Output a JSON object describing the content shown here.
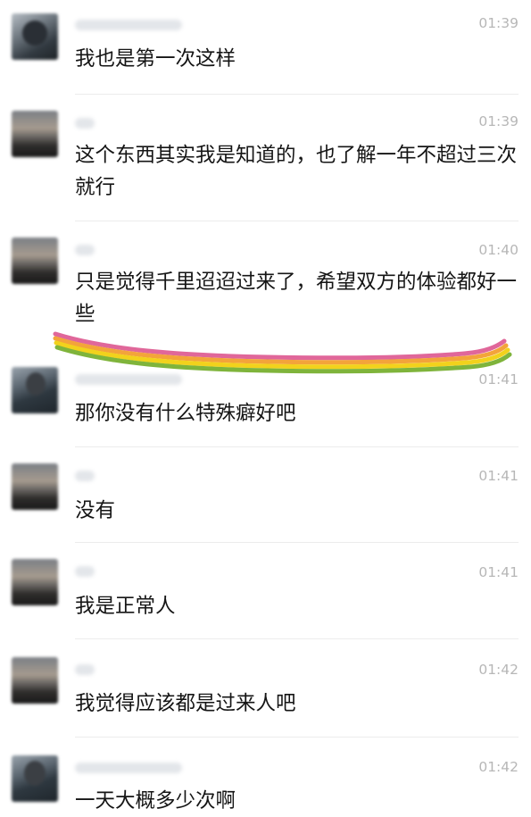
{
  "messages": [
    {
      "time": "01:39",
      "text": "我也是第一次这样"
    },
    {
      "time": "01:39",
      "text": "这个东西其实我是知道的，也了解一年不超过三次就行"
    },
    {
      "time": "01:40",
      "text": "只是觉得千里迢迢过来了，希望双方的体验都好一些"
    },
    {
      "time": "01:41",
      "text": "那你没有什么特殊癖好吧"
    },
    {
      "time": "01:41",
      "text": "没有"
    },
    {
      "time": "01:41",
      "text": "我是正常人"
    },
    {
      "time": "01:42",
      "text": "我觉得应该都是过来人吧"
    },
    {
      "time": "01:42",
      "text": "一天大概多少次啊"
    }
  ],
  "colors": {
    "rainbow": [
      "#e0679a",
      "#f3a43a",
      "#f2d21c",
      "#7fb43b"
    ]
  }
}
